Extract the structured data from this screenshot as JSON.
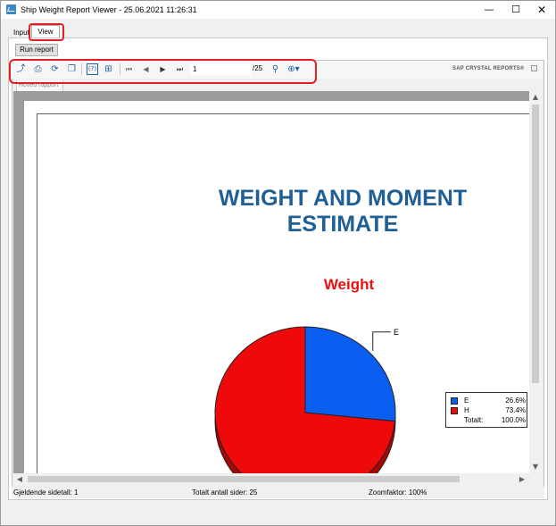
{
  "window": {
    "title": "Ship Weight Report Viewer - 25.06.2021 11:26:31",
    "minimize_glyph": "—",
    "maximize_glyph": "☐",
    "close_glyph": "✕"
  },
  "tabs": [
    {
      "label": "Input",
      "selected": false
    },
    {
      "label": "View",
      "selected": true
    }
  ],
  "run_report_label": "Run report",
  "toolbar": {
    "icons": [
      "export-icon",
      "print-icon",
      "refresh-icon",
      "copy-icon",
      "help-icon",
      "group-tree-icon",
      "first-page-icon",
      "prev-page-icon",
      "next-page-icon",
      "last-page-icon",
      "find-icon",
      "zoom-icon"
    ],
    "current_page": "1",
    "total_pages": "/25",
    "brand": "SAP CRYSTAL REPORTS®"
  },
  "group_tree_tab": "Hoved rapport",
  "report": {
    "title_line1": "WEIGHT AND MOMENT",
    "title_line2": "ESTIMATE",
    "chart_title": "Weight"
  },
  "chart_data": {
    "type": "pie",
    "title": "Weight",
    "slices": [
      {
        "label": "E",
        "value": 26.6,
        "percent_label": "26.6%",
        "color": "#0a5ef0"
      },
      {
        "label": "H",
        "value": 73.4,
        "percent_label": "73.4%",
        "color": "#ee0a0a"
      }
    ],
    "total_label": "Totalt:",
    "total_value": "100.0%",
    "callout_label": "E",
    "legend_position": "right"
  },
  "status": {
    "current_page": "Gjeldende sidetall: 1",
    "total_pages": "Totalt antall sider: 25",
    "zoom": "Zoomfaktor: 100%"
  },
  "colors": {
    "title_blue": "#1f5f96",
    "chart_title_red": "#ee0f0f",
    "annotation_red": "#e31e24"
  }
}
